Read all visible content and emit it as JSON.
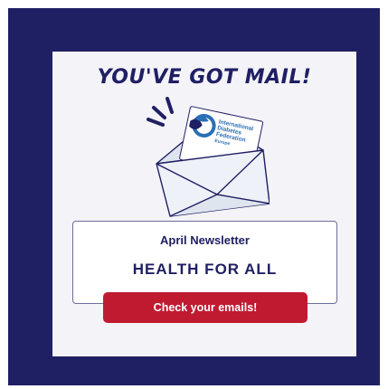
{
  "headline": "YOU'VE GOT MAIL!",
  "logo": {
    "line1": "International",
    "line2": "Diabetes",
    "line3": "Federation",
    "line4": "Europe"
  },
  "newsletter": {
    "label": "April Newsletter",
    "title": "HEALTH FOR ALL"
  },
  "cta": {
    "label": "Check your emails!"
  },
  "colors": {
    "navy": "#1f1f63",
    "card": "#f3f3f8",
    "cta": "#c01a31",
    "logo_blue": "#2a6fb5"
  }
}
